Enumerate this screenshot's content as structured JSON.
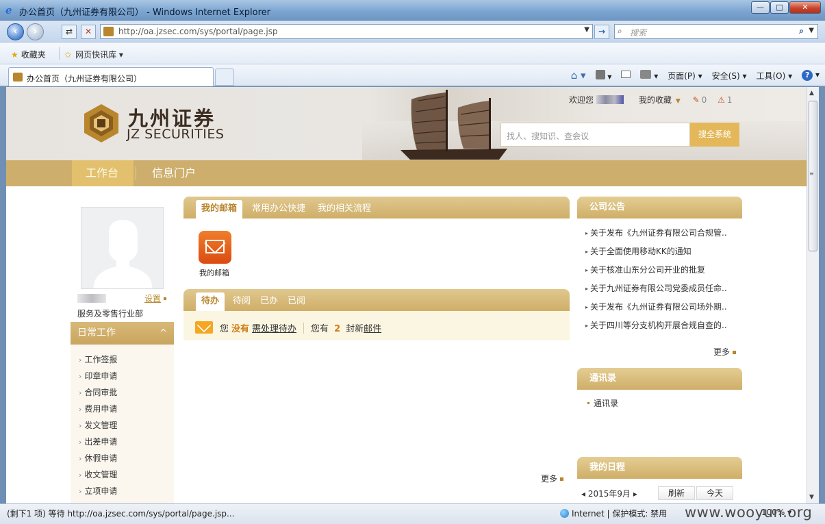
{
  "window": {
    "title": "办公首页（九州证券有限公司） - Windows Internet Explorer",
    "buttons": {
      "minimize": "—",
      "maximize": "□",
      "close": "✕"
    }
  },
  "browser": {
    "url": "http://oa.jzsec.com/sys/portal/page.jsp",
    "search_placeholder": "搜索",
    "favorites_label": "收藏夹",
    "quick_links_label": "网页快讯库 ▾",
    "tab_title": "办公首页（九州证券有限公司）",
    "commands": {
      "page": "页面(P) ▾",
      "safety": "安全(S) ▾",
      "tools": "工具(O) ▾"
    },
    "status_text": "(剩下1 项) 等待 http://oa.jzsec.com/sys/portal/page.jsp...",
    "zone_text": "Internet | 保护模式: 禁用",
    "zoom": "100% ▾",
    "watermark": "www.wooyun.org"
  },
  "header": {
    "logo_cn": "九州证券",
    "logo_en": "JZ SECURITIES",
    "welcome": "欢迎您",
    "my_favorites": "我的收藏",
    "edit_count": "0",
    "alert_count": "1",
    "search_placeholder": "找人、搜知识、查会议",
    "search_button": "搜全系统"
  },
  "nav": {
    "tabs": [
      {
        "label": "工作台",
        "active": true
      },
      {
        "label": "信息门户",
        "active": false
      }
    ]
  },
  "profile": {
    "settings_link": "设置",
    "department": "服务及零售行业部"
  },
  "daily_work": {
    "title": "日常工作",
    "collapse_icon": "^",
    "items": [
      "工作签报",
      "印章申请",
      "合同审批",
      "费用申请",
      "发文管理",
      "出差申请",
      "休假申请",
      "收文管理",
      "立项申请"
    ]
  },
  "mail_panel": {
    "tabs": [
      "我的邮箱",
      "常用办公快捷",
      "我的相关流程"
    ],
    "mailbox_label": "我的邮箱"
  },
  "todo_panel": {
    "tabs": [
      "待办",
      "待阅",
      "已办",
      "已阅"
    ],
    "you": "您",
    "none": "没有",
    "pending_link": "需处理待办",
    "you_have": "您有",
    "mail_count": "2",
    "new_mail_prefix": "封新",
    "new_mail_link": "邮件",
    "more": "更多"
  },
  "notices": {
    "title": "公司公告",
    "items": [
      "关于发布《九州证券有限公司合规管..",
      "关于全面使用移动KK的通知",
      "关于核准山东分公司开业的批复",
      "关于九州证券有限公司党委成员任命..",
      "关于发布《九州证券有限公司场外期..",
      "关于四川等分支机构开展合规自查的.."
    ],
    "more": "更多"
  },
  "contacts": {
    "title": "通讯录",
    "item": "通讯录"
  },
  "schedule": {
    "title": "我的日程",
    "month": "2015年9月",
    "refresh": "刷新",
    "today": "今天"
  },
  "colors": {
    "brand_gold": "#cdae6c",
    "accent_orange": "#d07a12"
  }
}
